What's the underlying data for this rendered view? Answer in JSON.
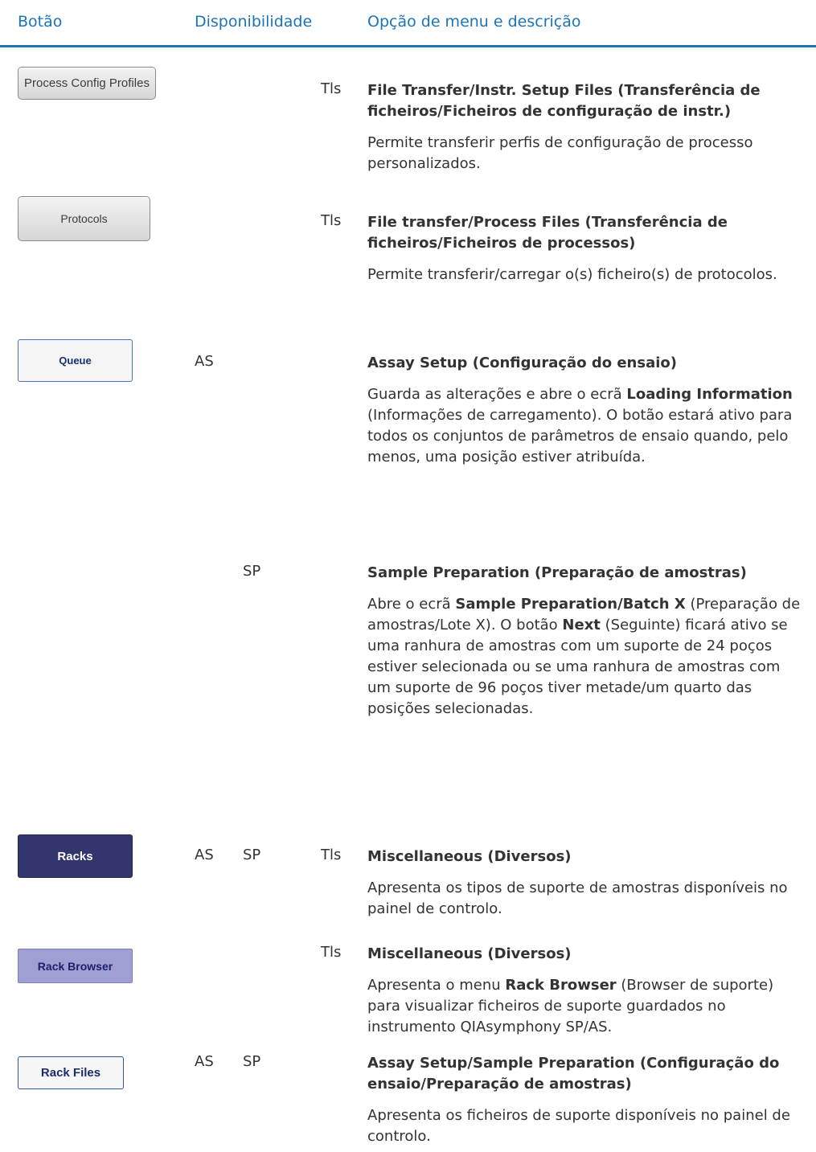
{
  "header": {
    "col_button": "Botão",
    "col_availability": "Disponibilidade",
    "col_option": "Opção de menu e descrição",
    "accent_color": "#1b74b8"
  },
  "rows": [
    {
      "button_label": "Process Config Profiles",
      "as": "",
      "sp": "",
      "tls": "Tls",
      "title": "File Transfer/Instr. Setup Files (Transferência de ficheiros/Ficheiros de configuração de instr.)",
      "description": "Permite transferir perfis de configuração de processo personalizados."
    },
    {
      "button_label": "Protocols",
      "as": "",
      "sp": "",
      "tls": "Tls",
      "title": "File transfer/Process Files (Transferência de ficheiros/Ficheiros de processos)",
      "description": "Permite transferir/carregar o(s) ficheiro(s) de protocolos."
    },
    {
      "button_label": "Queue",
      "as": "AS",
      "sp": "",
      "tls": "",
      "title": "Assay Setup (Configuração do ensaio)",
      "desc_1": "Guarda as alterações e abre o ecrã ",
      "desc_bold_1": "Loading Information",
      "desc_2": " (Informações de carregamento). O botão estará ativo para todos os conjuntos de parâmetros de ensaio quando, pelo menos, uma posição estiver atribuída."
    },
    {
      "button_label": "",
      "as": "",
      "sp": "SP",
      "tls": "",
      "title": "Sample Preparation (Preparação de amostras)",
      "desc_1": "Abre o ecrã ",
      "desc_bold_1": "Sample Preparation/Batch X",
      "desc_2": " (Preparação de amostras/Lote X). O botão ",
      "desc_bold_2": "Next",
      "desc_3": " (Seguinte) ficará ativo se uma ranhura de amostras com um suporte de 24 poços estiver selecionada ou se uma ranhura de amostras com um suporte de 96 poços tiver metade/um quarto das posições selecionadas."
    },
    {
      "button_label": "Racks",
      "as": "AS",
      "sp": "SP",
      "tls": "Tls",
      "title": "Miscellaneous (Diversos)",
      "description": "Apresenta os tipos de suporte de amostras disponíveis no painel de controlo."
    },
    {
      "button_label": "Rack Browser",
      "as": "",
      "sp": "",
      "tls": "Tls",
      "title": "Miscellaneous (Diversos)",
      "desc_1": "Apresenta o menu ",
      "desc_bold_1": "Rack Browser",
      "desc_2": " (Browser de suporte) para visualizar ficheiros de suporte guardados no instrumento QIAsymphony SP/AS."
    },
    {
      "button_label": "Rack Files",
      "as": "AS",
      "sp": "SP",
      "tls": "",
      "title": "Assay Setup/Sample Preparation (Configuração do ensaio/Preparação de amostras)",
      "description": "Apresenta os ficheiros de suporte disponíveis no painel de controlo."
    }
  ]
}
